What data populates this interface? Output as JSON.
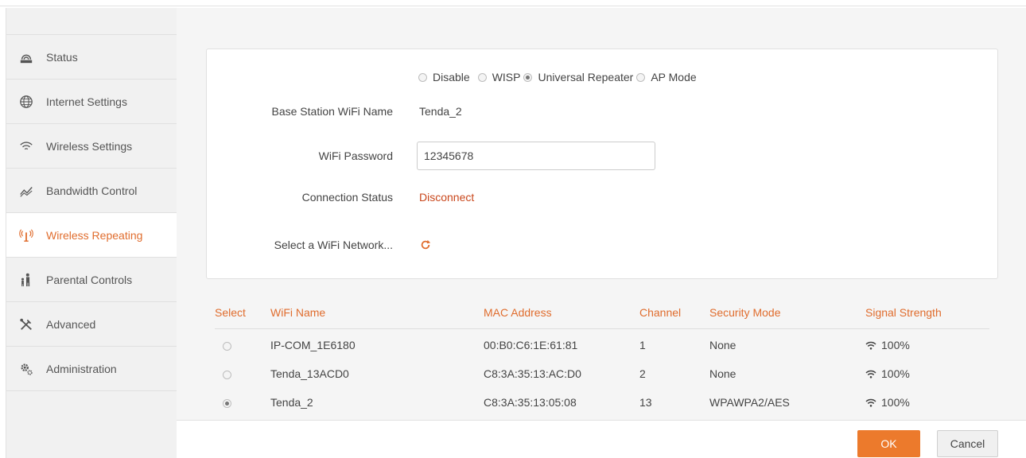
{
  "sidebar": {
    "items": [
      {
        "label": "Status",
        "icon": "router-icon",
        "active": false
      },
      {
        "label": "Internet Settings",
        "icon": "globe-icon",
        "active": false
      },
      {
        "label": "Wireless Settings",
        "icon": "wifi-icon",
        "active": false
      },
      {
        "label": "Bandwidth Control",
        "icon": "bandwidth-icon",
        "active": false
      },
      {
        "label": "Wireless Repeating",
        "icon": "antenna-icon",
        "active": true
      },
      {
        "label": "Parental Controls",
        "icon": "parent-child-icon",
        "active": false
      },
      {
        "label": "Advanced",
        "icon": "tools-icon",
        "active": false
      },
      {
        "label": "Administration",
        "icon": "gears-icon",
        "active": false
      }
    ]
  },
  "mode": {
    "options": [
      "Disable",
      "WISP",
      "Universal Repeater",
      "AP Mode"
    ],
    "selected": "Universal Repeater"
  },
  "form": {
    "base_station_label": "Base Station WiFi Name",
    "base_station_value": "Tenda_2",
    "password_label": "WiFi Password",
    "password_value": "12345678",
    "connection_label": "Connection Status",
    "connection_value": "Disconnect",
    "select_network_label": "Select a WiFi Network..."
  },
  "table": {
    "headers": [
      "Select",
      "WiFi Name",
      "MAC Address",
      "Channel",
      "Security Mode",
      "Signal Strength"
    ],
    "rows": [
      {
        "selected": false,
        "name": "IP-COM_1E6180",
        "mac": "00:B0:C6:1E:61:81",
        "channel": "1",
        "security": "None",
        "signal": "100%"
      },
      {
        "selected": false,
        "name": "Tenda_13ACD0",
        "mac": "C8:3A:35:13:AC:D0",
        "channel": "2",
        "security": "None",
        "signal": "100%"
      },
      {
        "selected": true,
        "name": "Tenda_2",
        "mac": "C8:3A:35:13:05:08",
        "channel": "13",
        "security": "WPAWPA2/AES",
        "signal": "100%"
      }
    ]
  },
  "footer": {
    "ok_label": "OK",
    "cancel_label": "Cancel"
  },
  "colors": {
    "accent": "#e06d2e",
    "ok_button": "#ec7a2c",
    "disconnect": "#c9471c"
  }
}
